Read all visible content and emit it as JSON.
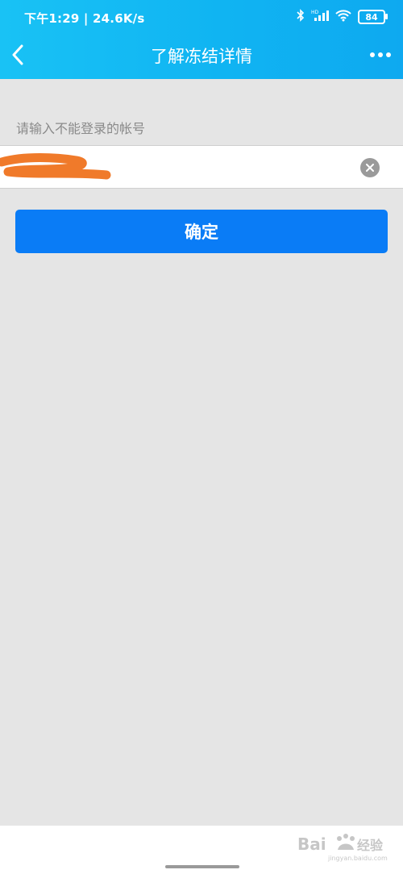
{
  "status_bar": {
    "time_speed": "下午1:29 | 24.6K/s",
    "battery": "84"
  },
  "nav": {
    "title": "了解冻结详情"
  },
  "form": {
    "label": "请输入不能登录的帐号",
    "account_value": "",
    "confirm_label": "确定"
  },
  "watermark": {
    "text": "Bai 经验",
    "url": "jingyan.baidu.com"
  },
  "colors": {
    "header": "#12b6f2",
    "button": "#0a7cf6",
    "background": "#e5e5e5",
    "redaction": "#f07a2a"
  }
}
